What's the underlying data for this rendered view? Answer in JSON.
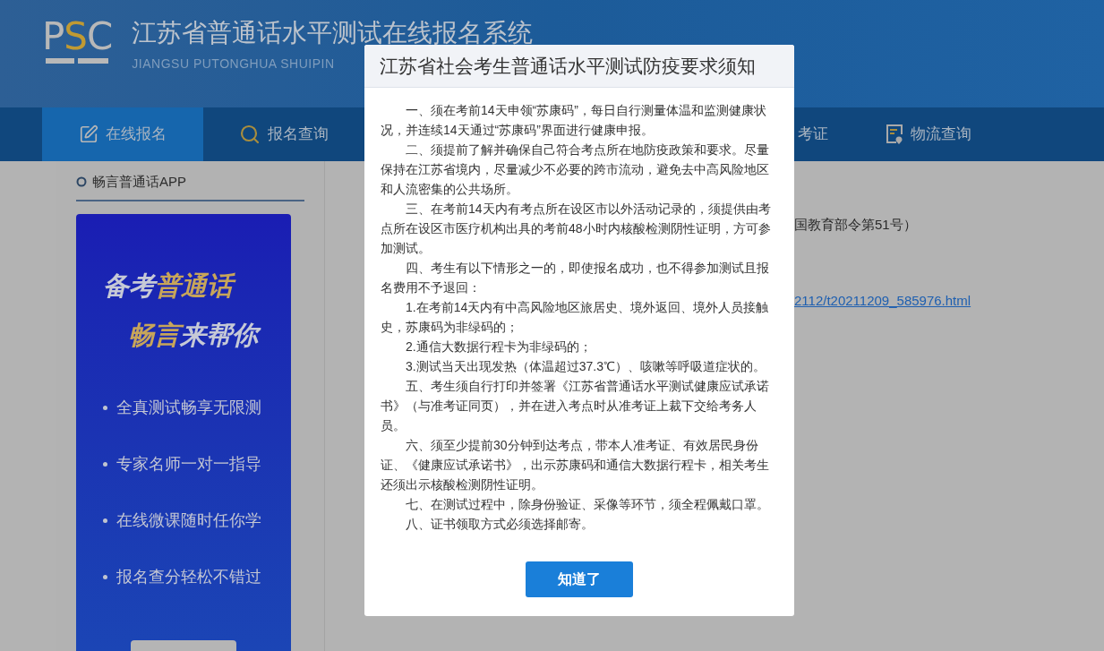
{
  "header": {
    "logo": {
      "left": "P",
      "accent": "S",
      "right": "C"
    },
    "title": "江苏省普通话水平测试在线报名系统",
    "subtitle": "JIANGSU PUTONGHUA SHUIPIN"
  },
  "nav": {
    "tabs": [
      {
        "label": "在线报名",
        "kind": "edit",
        "selected": true
      },
      {
        "label": "报名查询",
        "kind": "search",
        "selected": false
      },
      {
        "label": "考证",
        "kind": "partial",
        "selected": false
      },
      {
        "label": "物流查询",
        "kind": "document",
        "selected": false
      }
    ]
  },
  "sidebar": {
    "heading": "畅言普通话APP",
    "ad": {
      "headline": [
        [
          {
            "text": "备考",
            "highlight": false
          },
          {
            "text": "普通话",
            "highlight": true
          }
        ],
        [
          {
            "text": "畅言",
            "highlight": true
          },
          {
            "text": "来帮你",
            "highlight": false
          }
        ]
      ],
      "bullets": [
        "全真测试畅享无限测",
        "专家名师一对一指导",
        "在线微课随时任你学",
        "报名查分轻松不错过"
      ]
    }
  },
  "content": {
    "text": "国教育部令第51号）",
    "link": "2112/t20211209_585976.html"
  },
  "modal": {
    "title": "江苏省社会考生普通话水平测试防疫要求须知",
    "paragraphs": [
      "一、须在考前14天申领“苏康码”，每日自行测量体温和监测健康状况，并连续14天通过“苏康码”界面进行健康申报。",
      "二、须提前了解并确保自己符合考点所在地防疫政策和要求。尽量保持在江苏省境内，尽量减少不必要的跨市流动，避免去中高风险地区和人流密集的公共场所。",
      "三、在考前14天内有考点所在设区市以外活动记录的，须提供由考点所在设区市医疗机构出具的考前48小时内核酸检测阴性证明，方可参加测试。",
      "四、考生有以下情形之一的，即使报名成功，也不得参加测试且报名费用不予退回：",
      "1.在考前14天内有中高风险地区旅居史、境外返回、境外人员接触史，苏康码为非绿码的；",
      "2.通信大数据行程卡为非绿码的；",
      "3.测试当天出现发热（体温超过37.3℃）、咳嗽等呼吸道症状的。",
      "五、考生须自行打印并签署《江苏省普通话水平测试健康应试承诺书》（与准考证同页），并在进入考点时从准考证上裁下交给考务人员。",
      "六、须至少提前30分钟到达考点，带本人准考证、有效居民身份证、《健康应试承诺书》，出示苏康码和通信大数据行程卡，相关考生还须出示核酸检测阴性证明。",
      "七、在测试过程中，除身份验证、采像等环节，须全程佩戴口罩。",
      "八、证书领取方式必须选择邮寄。"
    ],
    "button": "知道了"
  }
}
